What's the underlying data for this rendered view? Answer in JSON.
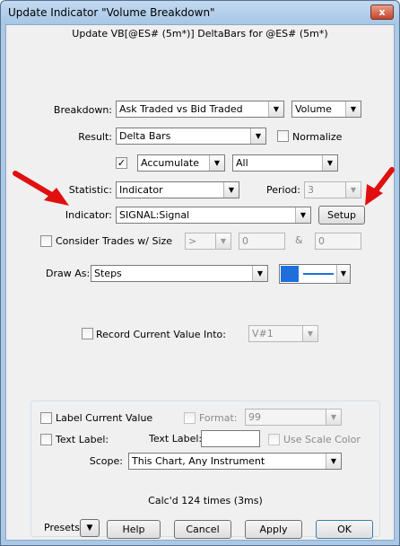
{
  "window": {
    "title": "Update Indicator \"Volume Breakdown\"",
    "close": "x"
  },
  "subtitle": "Update VB[@ES# (5m*)] DeltaBars for @ES# (5m*)",
  "breakdown": {
    "label": "Breakdown:",
    "value": "Ask Traded vs Bid Traded",
    "unit": "Volume"
  },
  "result": {
    "label": "Result:",
    "value": "Delta Bars",
    "normalize_label": "Normalize",
    "normalize_checked": false
  },
  "accumulate": {
    "checked": true,
    "check_glyph": "✓",
    "mode": "Accumulate",
    "range": "All"
  },
  "statistic": {
    "label": "Statistic:",
    "value": "Indicator",
    "period_label": "Period:",
    "period_value": "3"
  },
  "indicator": {
    "label": "Indicator:",
    "value": "SIGNAL:Signal",
    "setup_label": "Setup"
  },
  "consider": {
    "label": "Consider Trades w/ Size",
    "checked": false,
    "operator": ">",
    "value1": "0",
    "amp": "&",
    "value2": "0"
  },
  "draw_as": {
    "label": "Draw As:",
    "value": "Steps",
    "color": "#1e6fdc"
  },
  "record": {
    "label": "Record Current Value Into:",
    "checked": false,
    "value": "V#1"
  },
  "group": {
    "label_current_value": "Label Current Value",
    "format_label": "Format:",
    "format_value": "99",
    "text_label_check": "Text Label:",
    "text_label_field": "Text Label:",
    "text_label_value": "",
    "use_scale_color": "Use Scale Color",
    "scope_label": "Scope:",
    "scope_value": "This Chart, Any Instrument",
    "calc_status": "Calc'd 124 times (3ms)"
  },
  "footer": {
    "presets": "Presets",
    "help": "Help",
    "cancel": "Cancel",
    "apply": "Apply",
    "ok": "OK"
  },
  "colors": {
    "arrow": "#e01010",
    "title_bg": "#a6c6e6"
  }
}
